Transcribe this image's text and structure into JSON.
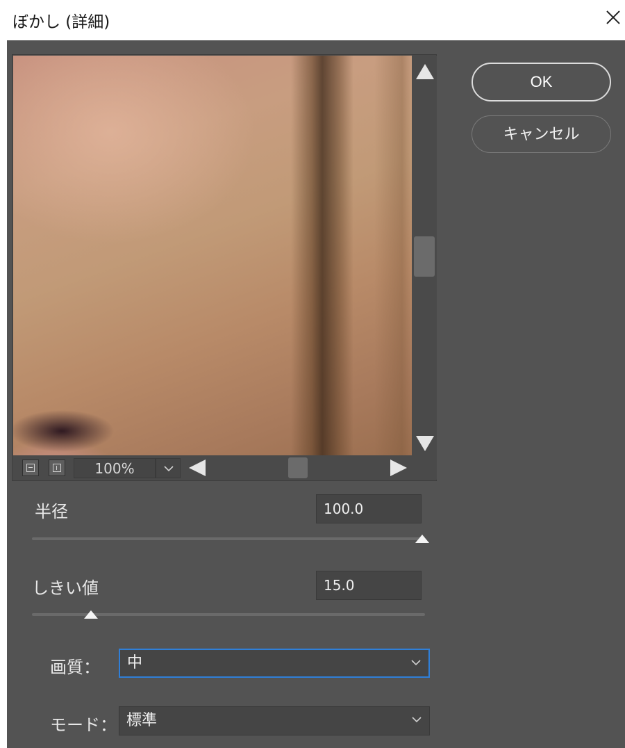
{
  "window": {
    "title": "ぼかし (詳細)",
    "close_icon": "close-icon"
  },
  "preview": {
    "zoom_value": "100%",
    "zoom_out_icon": "zoom-out-icon",
    "zoom_in_icon": "zoom-in-icon"
  },
  "buttons": {
    "ok_label": "OK",
    "cancel_label": "キャンセル"
  },
  "radius": {
    "label": "半径",
    "value": "100.0",
    "slider_fraction": 1.0
  },
  "threshold": {
    "label": "しきい値",
    "value": "15.0",
    "slider_fraction": 0.15
  },
  "quality": {
    "label": "画質：",
    "selected": "中"
  },
  "mode": {
    "label": "モード：",
    "selected": "標準"
  },
  "colors": {
    "dialog_bg": "#535353",
    "focus_border": "#2f7fd8"
  }
}
